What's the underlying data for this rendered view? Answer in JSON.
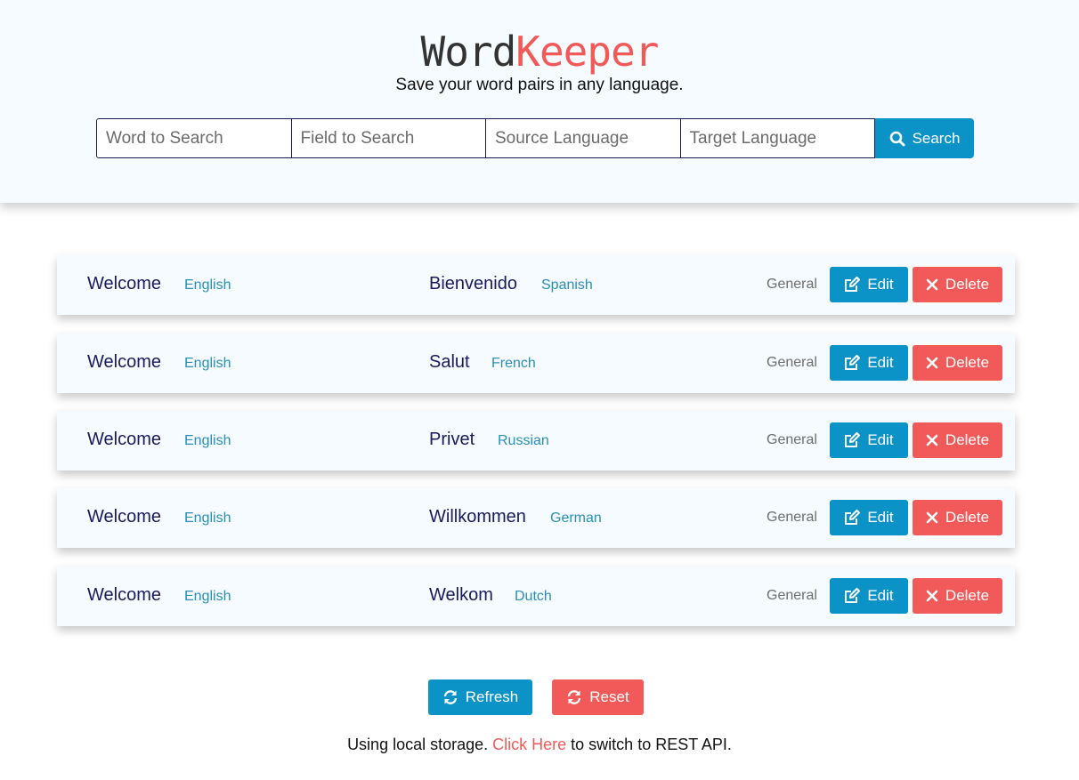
{
  "header": {
    "logo_part1": "Word",
    "logo_part2": "Keeper",
    "tagline": "Save your word pairs in any language."
  },
  "search": {
    "word_placeholder": "Word to Search",
    "field_placeholder": "Field to Search",
    "source_placeholder": "Source Language",
    "target_placeholder": "Target Language",
    "button_label": "Search"
  },
  "entries": [
    {
      "source_word": "Welcome",
      "source_lang": "English",
      "target_word": "Bienvenido",
      "target_lang": "Spanish",
      "category": "General",
      "edit_label": "Edit",
      "delete_label": "Delete"
    },
    {
      "source_word": "Welcome",
      "source_lang": "English",
      "target_word": "Salut",
      "target_lang": "French",
      "category": "General",
      "edit_label": "Edit",
      "delete_label": "Delete"
    },
    {
      "source_word": "Welcome",
      "source_lang": "English",
      "target_word": "Privet",
      "target_lang": "Russian",
      "category": "General",
      "edit_label": "Edit",
      "delete_label": "Delete"
    },
    {
      "source_word": "Welcome",
      "source_lang": "English",
      "target_word": "Willkommen",
      "target_lang": "German",
      "category": "General",
      "edit_label": "Edit",
      "delete_label": "Delete"
    },
    {
      "source_word": "Welcome",
      "source_lang": "English",
      "target_word": "Welkom",
      "target_lang": "Dutch",
      "category": "General",
      "edit_label": "Edit",
      "delete_label": "Delete"
    }
  ],
  "actions": {
    "refresh_label": "Refresh",
    "reset_label": "Reset"
  },
  "footer": {
    "text_before": "Using local storage. ",
    "link_text": "Click Here",
    "text_after": " to switch to REST API."
  },
  "colors": {
    "primary": "#0b93c8",
    "danger": "#f25a5a",
    "header_bg": "#f5fbfe",
    "text_dark": "#1a1a5e",
    "lang_text": "#2a8fb5"
  },
  "icons": {
    "search": "search-icon",
    "edit": "edit-icon",
    "delete": "close-icon",
    "refresh": "refresh-icon"
  }
}
